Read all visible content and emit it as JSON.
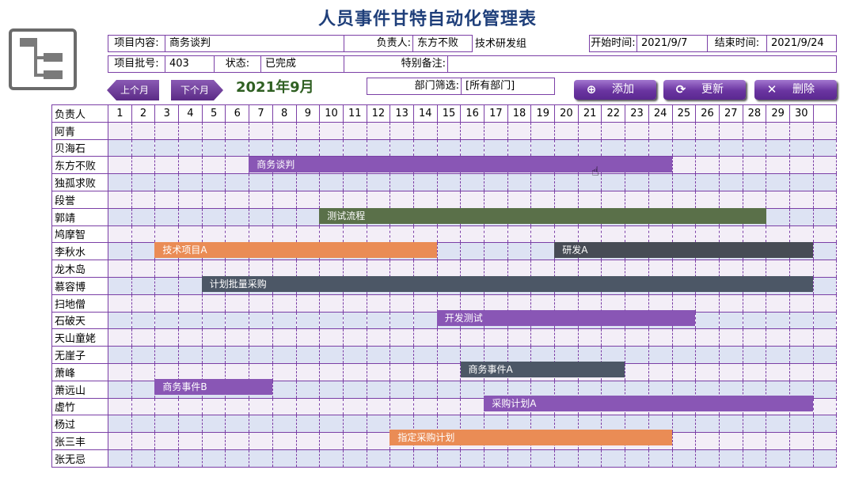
{
  "title": "人员事件甘特自动化管理表",
  "form": {
    "project_content_label": "项目内容:",
    "project_content_value": "商务谈判",
    "owner_label": "负责人:",
    "owner_value": "东方不败",
    "department_value": "技术研发组",
    "start_label": "开始时间:",
    "start_value": "2021/9/7",
    "end_label": "结束时间:",
    "end_value": "2021/9/24",
    "batch_label": "项目批号:",
    "batch_value": "403",
    "status_label": "状态:",
    "status_value": "已完成",
    "remark_label": "特别备注:",
    "remark_value": ""
  },
  "nav": {
    "prev_label": "上个月",
    "next_label": "下个月",
    "month": "2021年9月"
  },
  "filter": {
    "label": "部门筛选:",
    "value": "[所有部门]"
  },
  "actions": {
    "add_label": "添加",
    "refresh_label": "更新",
    "delete_label": "删除"
  },
  "grid": {
    "owner_header": "负责人",
    "days": [
      "1",
      "2",
      "3",
      "4",
      "5",
      "6",
      "7",
      "8",
      "9",
      "10",
      "11",
      "12",
      "13",
      "14",
      "15",
      "16",
      "17",
      "18",
      "19",
      "20",
      "21",
      "22",
      "23",
      "24",
      "25",
      "26",
      "27",
      "28",
      "29",
      "30",
      ""
    ],
    "people": [
      "阿青",
      "贝海石",
      "东方不败",
      "独孤求败",
      "段誉",
      "郭靖",
      "鸠摩智",
      "李秋水",
      "龙木岛",
      "慕容博",
      "扫地僧",
      "石破天",
      "天山童姥",
      "无崖子",
      "萧峰",
      "萧远山",
      "虚竹",
      "杨过",
      "张三丰",
      "张无忌"
    ]
  },
  "tasks": [
    {
      "label": "商务谈判",
      "row": 2,
      "start": 7,
      "end": 24,
      "color": "#8956b5"
    },
    {
      "label": "测试流程",
      "row": 5,
      "start": 10,
      "end": 28,
      "color": "#5a7049"
    },
    {
      "label": "技术项目A",
      "row": 7,
      "start": 3,
      "end": 14,
      "color": "#ea8c55"
    },
    {
      "label": "研发A",
      "row": 7,
      "start": 20,
      "end": 30,
      "color": "#474c55"
    },
    {
      "label": "计划批量采购",
      "row": 9,
      "start": 5,
      "end": 30,
      "color": "#4c5766"
    },
    {
      "label": "开发测试",
      "row": 11,
      "start": 15,
      "end": 25,
      "color": "#8956b5"
    },
    {
      "label": "商务事件A",
      "row": 14,
      "start": 16,
      "end": 22,
      "color": "#4c5766"
    },
    {
      "label": "商务事件B",
      "row": 15,
      "start": 3,
      "end": 7,
      "color": "#8956b5"
    },
    {
      "label": "采购计划A",
      "row": 16,
      "start": 17,
      "end": 30,
      "color": "#8956b5"
    },
    {
      "label": "指定采购计划",
      "row": 18,
      "start": 13,
      "end": 24,
      "color": "#ea8c55"
    }
  ]
}
